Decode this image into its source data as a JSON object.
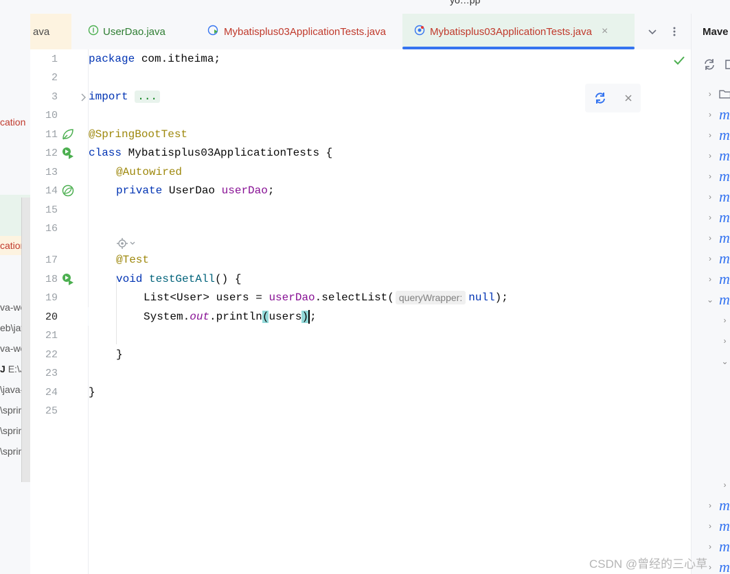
{
  "window": {
    "title_fragment": "yo…pp"
  },
  "tabs": [
    {
      "label": "ava",
      "color": "#4b4b4b"
    },
    {
      "label": "UserDao.java",
      "color": "#2e7d32"
    },
    {
      "label": "Mybatisplus03ApplicationTests.java",
      "color": "#c0392b"
    },
    {
      "label": "Mybatisplus03ApplicationTests.java",
      "color": "#c0392b",
      "active": true,
      "close": "×"
    }
  ],
  "left_panel": {
    "rows": [
      "cation",
      "cation",
      "va-web",
      "eb\\jav",
      "va-we",
      "E:\\Ja",
      "\\java-",
      "\\sprin",
      "\\sprin",
      "\\sprin"
    ]
  },
  "editor": {
    "line_numbers": [
      "1",
      "2",
      "3",
      "10",
      "11",
      "12",
      "13",
      "14",
      "15",
      "16",
      "17",
      "18",
      "19",
      "20",
      "21",
      "22",
      "23",
      "24",
      "25"
    ],
    "code": {
      "l1_kw": "package",
      "l1_rest": " com.itheima;",
      "l3_kw": "import",
      "l3_fold": "...",
      "l11": "@SpringBootTest",
      "l12_kw": "class",
      "l12_rest": " Mybatisplus03ApplicationTests {",
      "l13": "@Autowired",
      "l14_kw": "private",
      "l14_type": " UserDao ",
      "l14_field": "userDao",
      "l14_end": ";",
      "l17": "@Test",
      "l18_kw": "void",
      "l18_sp": " ",
      "l18_fn": "testGetAll",
      "l18_rest": "() {",
      "l19_a": "List<User> users = ",
      "l19_field": "userDao",
      "l19_b": ".selectList(",
      "l19_hint": "queryWrapper:",
      "l19_null": "null",
      "l19_end": ");",
      "l20_a": "System.",
      "l20_out": "out",
      "l20_b": ".println",
      "l20_open": "(",
      "l20_arg": "users",
      "l20_close": ")",
      "l20_end": ";",
      "l22": "}",
      "l24": "}"
    },
    "cursor_line": 20
  },
  "maven_panel": {
    "title": "Mave",
    "item_label": "m"
  },
  "watermark": "CSDN @曾经的三心草",
  "colors": {
    "accent": "#3574f0",
    "keyword": "#0033b3",
    "annotation": "#9e880d",
    "field": "#871094",
    "run_green": "#4caf50"
  },
  "icons": {
    "run": "run-test-icon",
    "spring": "spring-leaf-icon",
    "bean": "bean-icon",
    "bulb": "lightbulb-icon",
    "refresh": "refresh-icon"
  }
}
